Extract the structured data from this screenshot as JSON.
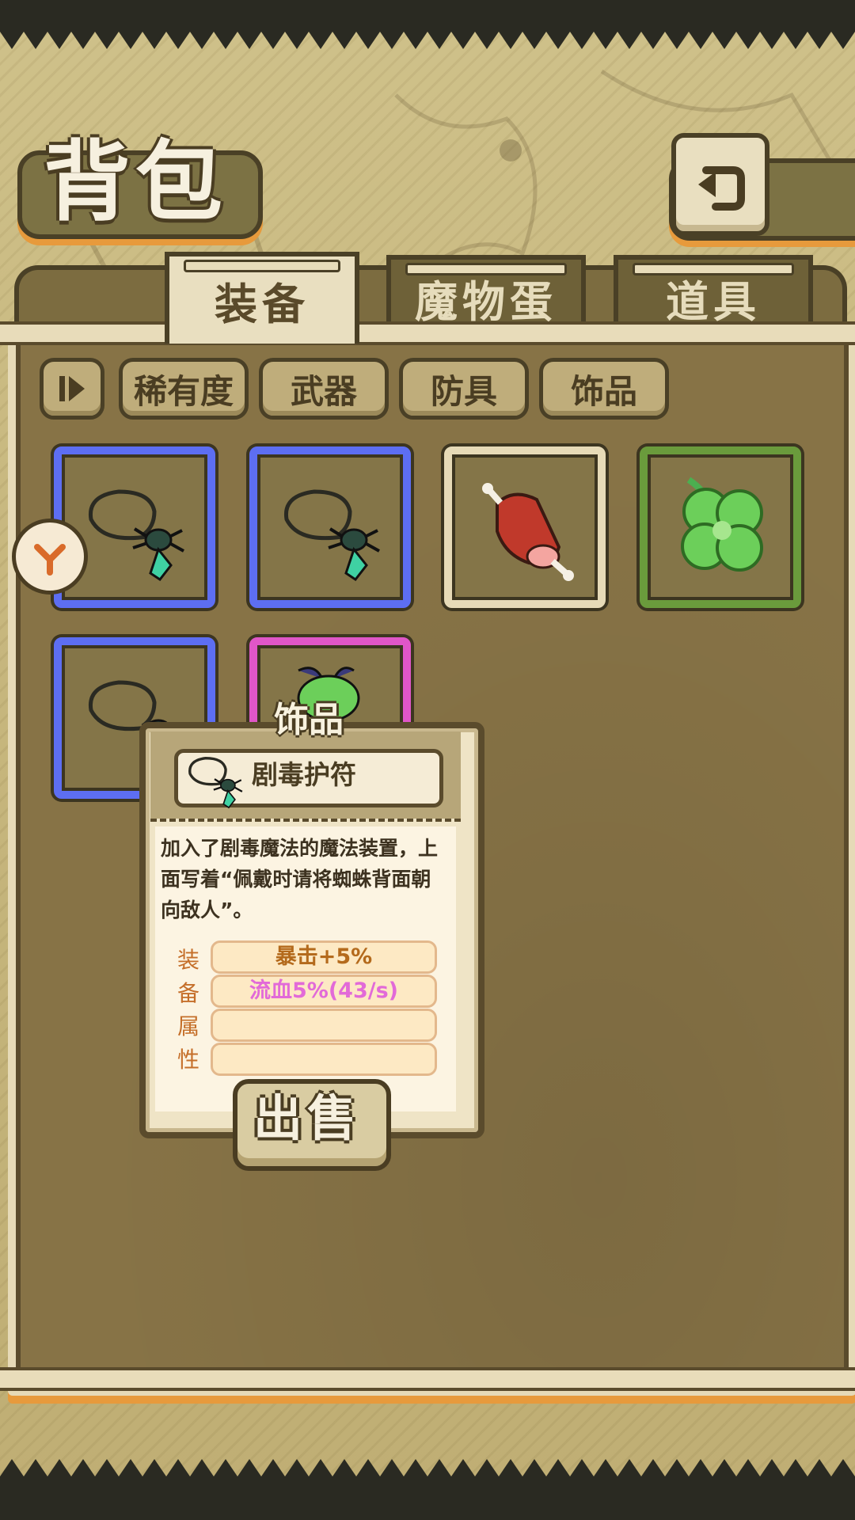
{
  "header": {
    "title": "背包",
    "back_icon": "return-arrow-icon"
  },
  "tabs": [
    {
      "label": "装备",
      "active": true
    },
    {
      "label": "魔物蛋",
      "active": false
    },
    {
      "label": "道具",
      "active": false
    }
  ],
  "filters": {
    "toggle_icon": "collapse-icon",
    "buttons": [
      "稀有度",
      "武器",
      "防具",
      "饰品"
    ]
  },
  "items": [
    {
      "icon": "spider-amulet-icon",
      "rarity": "rare",
      "rarity_color": "#5d6ef2"
    },
    {
      "icon": "spider-amulet-icon",
      "rarity": "rare",
      "rarity_color": "#5d6ef2"
    },
    {
      "icon": "meat-icon",
      "rarity": "common",
      "rarity_color": "#e6dab7"
    },
    {
      "icon": "four-leaf-clover-icon",
      "rarity": "uncommon",
      "rarity_color": "#6a9b3c"
    },
    {
      "icon": "spider-amulet-icon",
      "rarity": "rare",
      "rarity_color": "#5d6ef2"
    },
    {
      "icon": "beetle-accessory-icon",
      "rarity": "epic",
      "rarity_color": "#e056c8"
    }
  ],
  "side_arrow_icon": "curved-arrow-icon",
  "tooltip": {
    "category": "饰品",
    "name": "剧毒护符",
    "item_icon": "spider-amulet-icon",
    "description": "加入了剧毒魔法的魔法装置，上面写着“佩戴时请将蜘蛛背面朝向敌人”。",
    "attr_label": [
      "装",
      "备",
      "属",
      "性"
    ],
    "attributes": [
      {
        "text": "暴击+5%",
        "color": "#b46a1c"
      },
      {
        "text": "流血5%(43/s)",
        "color": "#e26ad8"
      },
      {
        "text": "",
        "color": "#b46a1c"
      },
      {
        "text": "",
        "color": "#b46a1c"
      }
    ],
    "sell_label": "出售"
  },
  "colors": {
    "accent_orange": "#e79a3c",
    "frame_dark": "#4a3d22",
    "panel": "#877346"
  }
}
